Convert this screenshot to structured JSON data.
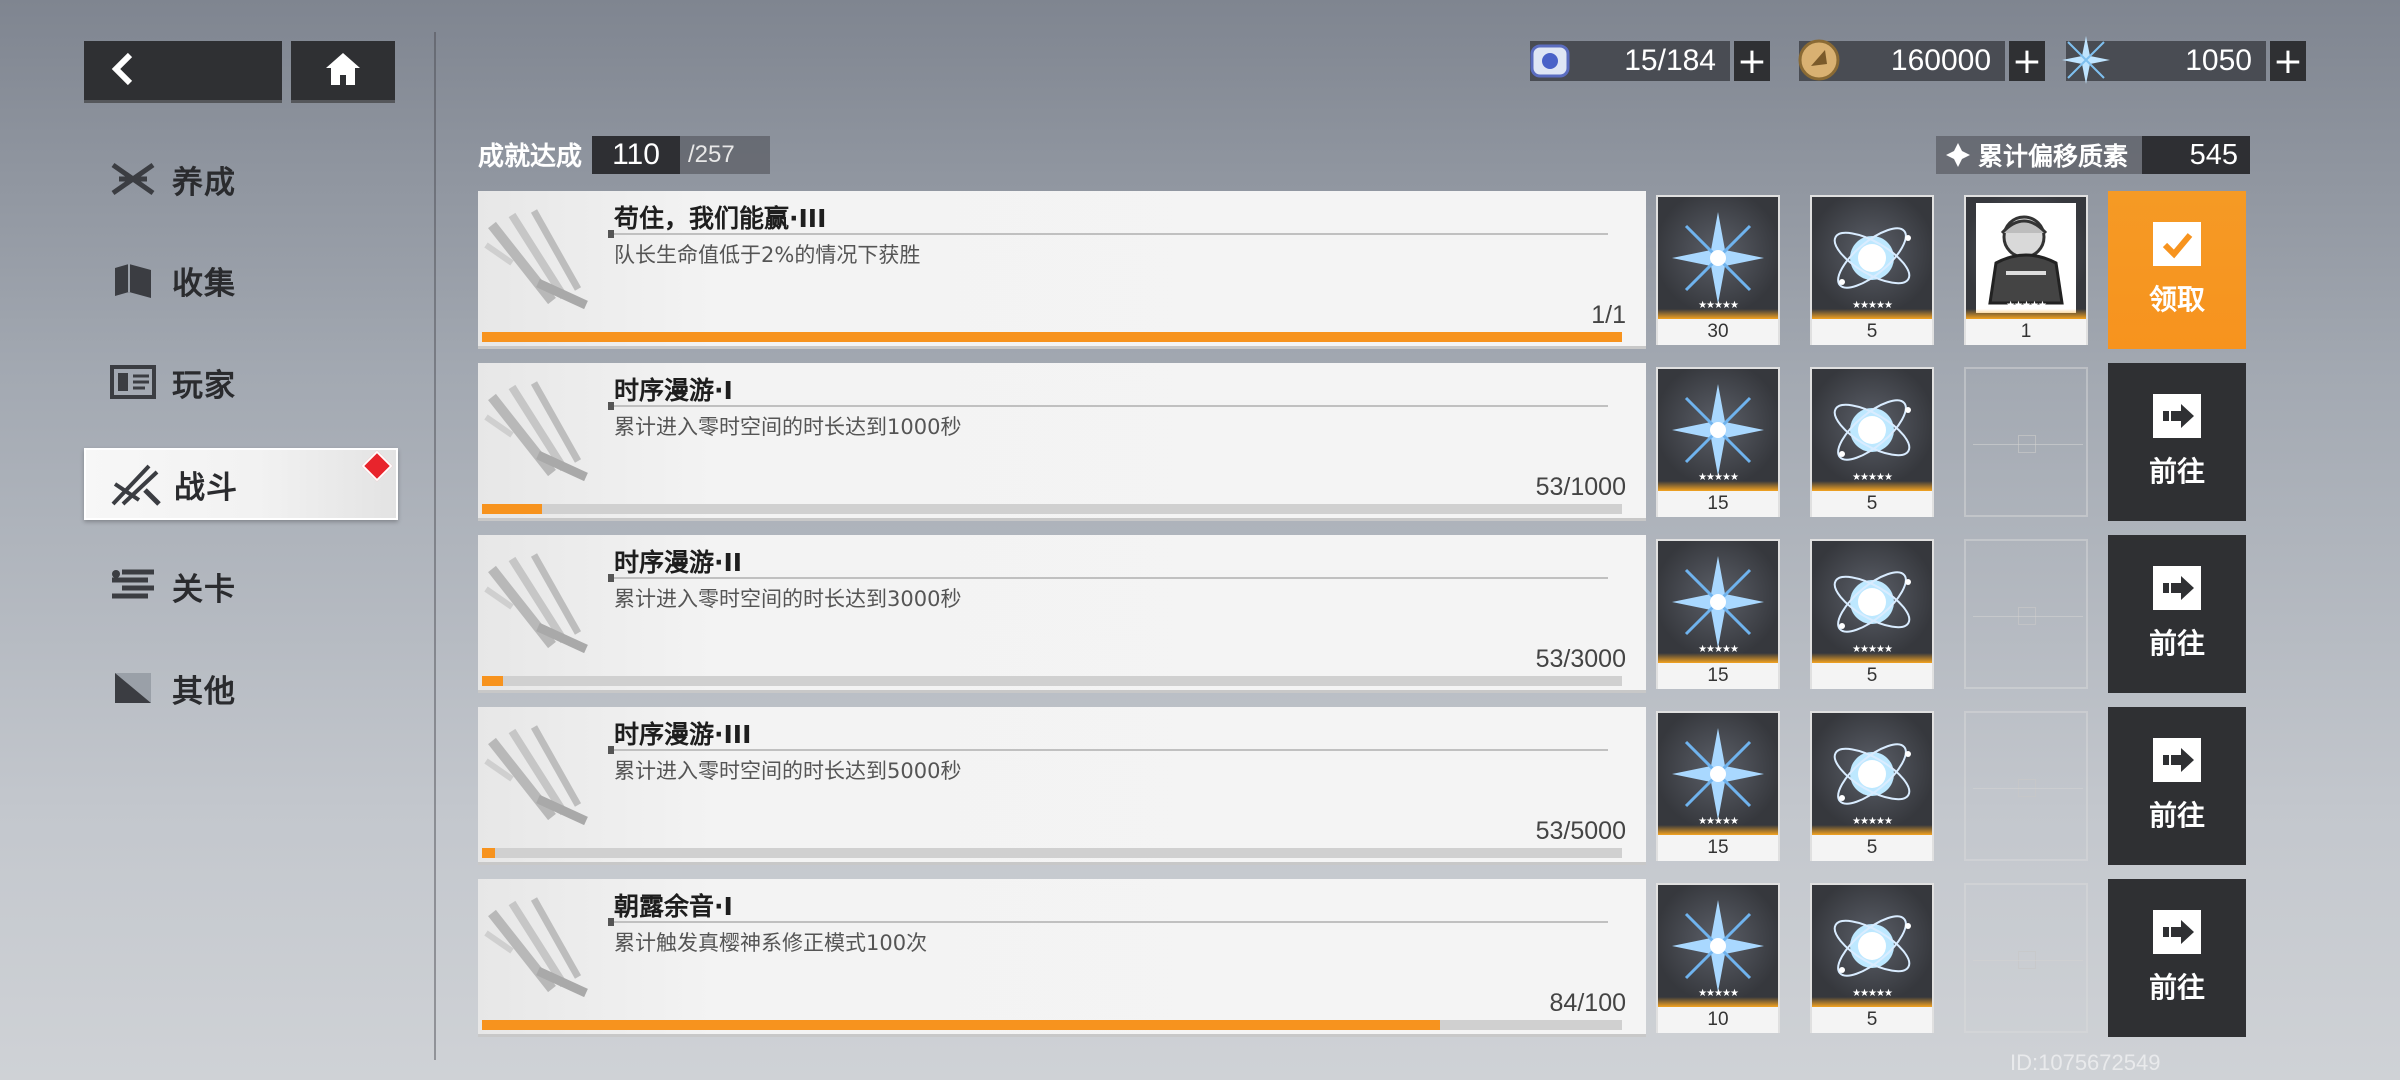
{
  "nav": {
    "back_icon": "back-arrow-icon",
    "home_icon": "home-icon"
  },
  "sidebar": {
    "items": [
      {
        "label": "养成",
        "icon": "cultivate-icon",
        "active": false
      },
      {
        "label": "收集",
        "icon": "collection-icon",
        "active": false
      },
      {
        "label": "玩家",
        "icon": "player-icon",
        "active": false
      },
      {
        "label": "战斗",
        "icon": "battle-icon",
        "active": true
      },
      {
        "label": "关卡",
        "icon": "stage-icon",
        "active": false
      },
      {
        "label": "其他",
        "icon": "other-icon",
        "active": false
      }
    ]
  },
  "currencies": [
    {
      "value": "15/184",
      "icon": "stamina-icon"
    },
    {
      "value": "160000",
      "icon": "coin-icon"
    },
    {
      "value": "1050",
      "icon": "crystal-icon"
    }
  ],
  "summary": {
    "label": "成就达成",
    "achieved": "110",
    "total": "/257",
    "accum_label": "累计偏移质素",
    "accum_value": "545"
  },
  "achievements": [
    {
      "title": "苟住，我们能赢·III",
      "desc": "队长生命值低于2%的情况下获胜",
      "progress": "1/1",
      "fraction": 1.0,
      "rewards": [
        {
          "icon": "crystal-reward-icon",
          "qty": "30"
        },
        {
          "icon": "orb-reward-icon",
          "qty": "5"
        },
        {
          "icon": "character-reward-icon",
          "qty": "1"
        }
      ],
      "action": "领取",
      "action_type": "claim"
    },
    {
      "title": "时序漫游·I",
      "desc": "累计进入零时空间的时长达到1000秒",
      "progress": "53/1000",
      "fraction": 0.053,
      "rewards": [
        {
          "icon": "crystal-reward-icon",
          "qty": "15"
        },
        {
          "icon": "orb-reward-icon",
          "qty": "5"
        }
      ],
      "action": "前往",
      "action_type": "go"
    },
    {
      "title": "时序漫游·II",
      "desc": "累计进入零时空间的时长达到3000秒",
      "progress": "53/3000",
      "fraction": 0.018,
      "rewards": [
        {
          "icon": "crystal-reward-icon",
          "qty": "15"
        },
        {
          "icon": "orb-reward-icon",
          "qty": "5"
        }
      ],
      "action": "前往",
      "action_type": "go"
    },
    {
      "title": "时序漫游·III",
      "desc": "累计进入零时空间的时长达到5000秒",
      "progress": "53/5000",
      "fraction": 0.011,
      "rewards": [
        {
          "icon": "crystal-reward-icon",
          "qty": "15"
        },
        {
          "icon": "orb-reward-icon",
          "qty": "5"
        }
      ],
      "action": "前往",
      "action_type": "go"
    },
    {
      "title": "朝露余音·I",
      "desc": "累计触发真樱神系修正模式100次",
      "progress": "84/100",
      "fraction": 0.84,
      "rewards": [
        {
          "icon": "crystal-reward-icon",
          "qty": "10"
        },
        {
          "icon": "orb-reward-icon",
          "qty": "5"
        }
      ],
      "action": "前往",
      "action_type": "go"
    }
  ],
  "uid": "ID:1075672549",
  "colors": {
    "accent": "#f7931e",
    "dark": "#2f3033",
    "badge": "#e8242c"
  }
}
